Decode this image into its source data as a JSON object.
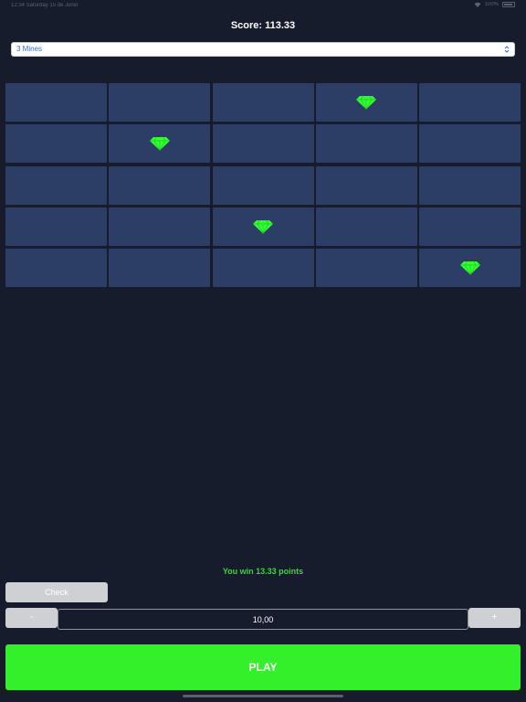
{
  "status_bar": {
    "left_text": "12:34   Saturday 15 de Junio",
    "battery_text": "100%"
  },
  "game": {
    "score_text": "Score: 113.33",
    "mines_select": {
      "selected": "3 Mines",
      "icon": "chevron-updown-icon"
    },
    "grid": {
      "rows": 5,
      "cols": 5,
      "tile_color": "#2c3e66",
      "gem_color": "#33ff33",
      "revealed_gems": [
        {
          "row": 0,
          "col": 3
        },
        {
          "row": 1,
          "col": 1
        },
        {
          "row": 3,
          "col": 2
        },
        {
          "row": 4,
          "col": 4
        }
      ]
    },
    "result_text": "You win 13.33 points",
    "result_color": "#3ad63a"
  },
  "controls": {
    "check_label": "Check",
    "minus_label": "-",
    "plus_label": "+",
    "bet_value": "10,00",
    "play_label": "PLAY",
    "play_color": "#33f02a"
  }
}
